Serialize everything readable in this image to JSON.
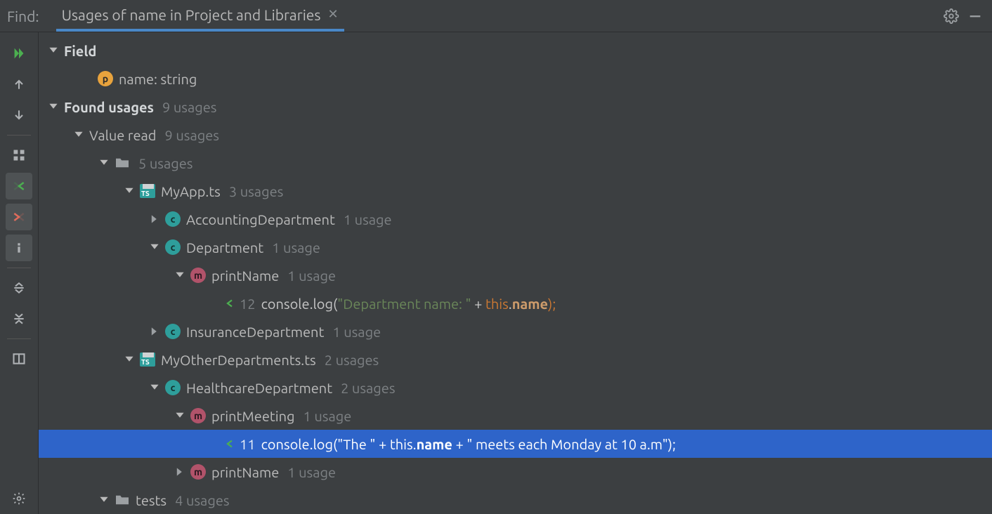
{
  "header": {
    "label": "Find:",
    "tab_title": "Usages of name in Project and Libraries"
  },
  "tree": {
    "field_label": "Field",
    "field_item": "name: string",
    "found_label": "Found usages",
    "found_count": "9 usages",
    "value_read_label": "Value read",
    "value_read_count": "9 usages",
    "dir1_count": "5 usages",
    "file1_name": "MyApp.ts",
    "file1_count": "3 usages",
    "class1": "AccountingDepartment",
    "class1_count": "1 usage",
    "class2": "Department",
    "class2_count": "1 usage",
    "method1": "printName",
    "method1_count": "1 usage",
    "line12_num": "12",
    "line12_fn": "console.log",
    "line12_str": "\"Department name: \"",
    "line12_kw": "this",
    "line12_name": "name",
    "class3": "InsuranceDepartment",
    "class3_count": "1 usage",
    "file2_name": "MyOtherDepartments.ts",
    "file2_count": "2 usages",
    "class4": "HealthcareDepartment",
    "class4_count": "2 usages",
    "method2": "printMeeting",
    "method2_count": "1 usage",
    "line11_num": "11",
    "line11_pre": "console.log(\"The \" + this.",
    "line11_name": "name",
    "line11_post": " +  \" meets each Monday at 10 a.m\");",
    "method3": "printName",
    "method3_count": "1 usage",
    "dir2_name": "tests",
    "dir2_count": "4 usages"
  }
}
